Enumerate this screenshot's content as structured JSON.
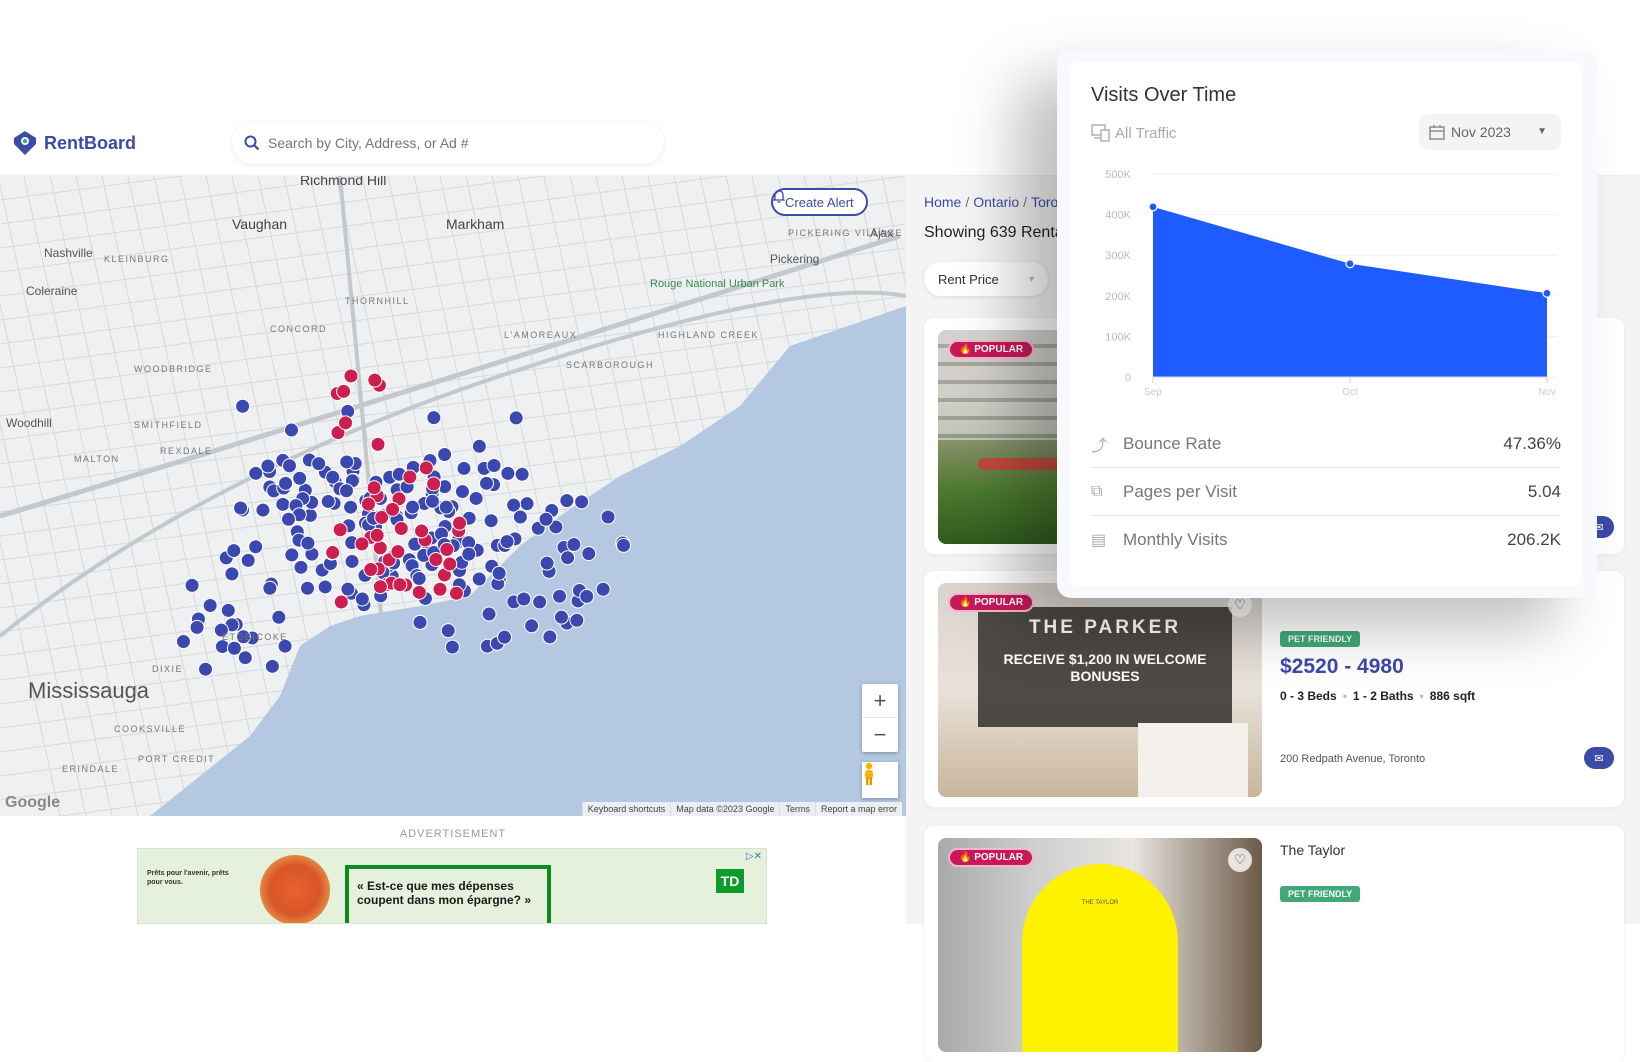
{
  "header": {
    "brand": "RentBoard",
    "search_placeholder": "Search by City, Address, or Ad #"
  },
  "map": {
    "create_alert_label": "Create Alert",
    "zoom_in": "+",
    "zoom_out": "−",
    "google_label": "Google",
    "footer_links": [
      "Keyboard shortcuts",
      "Map data ©2023 Google",
      "Terms",
      "Report a map error"
    ],
    "labels": [
      {
        "text": "Richmond Hill",
        "cls": "big"
      },
      {
        "text": "Vaughan",
        "cls": "big"
      },
      {
        "text": "Markham",
        "cls": "big"
      },
      {
        "text": "Nashville",
        "cls": ""
      },
      {
        "text": "KLEINBURG",
        "cls": "small"
      },
      {
        "text": "Coleraine",
        "cls": ""
      },
      {
        "text": "Pickering",
        "cls": ""
      },
      {
        "text": "PICKERING VILLAGE",
        "cls": "small"
      },
      {
        "text": "Ajax",
        "cls": ""
      },
      {
        "text": "CONCORD",
        "cls": "small"
      },
      {
        "text": "THORNHILL",
        "cls": "small"
      },
      {
        "text": "WOODBRIDGE",
        "cls": "small"
      },
      {
        "text": "Woodhill",
        "cls": ""
      },
      {
        "text": "SMITHFIELD",
        "cls": "small"
      },
      {
        "text": "REXDALE",
        "cls": "small"
      },
      {
        "text": "MALTON",
        "cls": "small"
      },
      {
        "text": "SCARBOROUGH",
        "cls": "small"
      },
      {
        "text": "L'AMOREAUX",
        "cls": "small"
      },
      {
        "text": "HIGHLAND CREEK",
        "cls": "small"
      },
      {
        "text": "Mississauga",
        "cls": "huge"
      },
      {
        "text": "DIXIE",
        "cls": "small"
      },
      {
        "text": "COOKSVILLE",
        "cls": "small"
      },
      {
        "text": "PORT CREDIT",
        "cls": "small"
      },
      {
        "text": "ERINDALE",
        "cls": "small"
      },
      {
        "text": "ETOBICOKE",
        "cls": "small"
      }
    ],
    "park_label": "Rouge National Urban Park"
  },
  "advertisement": {
    "label": "ADVERTISEMENT",
    "small_text": "Prêts pour l'avenir, prêts pour vous.",
    "quote": "« Est-ce que mes dépenses coupent dans mon épargne? »",
    "brand": "TD"
  },
  "listings": {
    "breadcrumb": [
      "Home",
      "Ontario",
      "Toronto"
    ],
    "showing_text": "Showing 639 Rentals",
    "filter_label": "Rent Price",
    "cards": [
      {
        "badge": "POPULAR",
        "name": "",
        "pet": "",
        "price": "",
        "specs": [],
        "address": ""
      },
      {
        "badge": "POPULAR",
        "name": "Parker",
        "pet": "PET FRIENDLY",
        "price": "$2520 - 4980",
        "specs": [
          "0 - 3 Beds",
          "1 - 2 Baths",
          "886 sqft"
        ],
        "address": "200 Redpath Avenue, Toronto",
        "photo_headline": "THE PARKER",
        "photo_sub": "RECEIVE $1,200 IN WELCOME BONUSES"
      },
      {
        "badge": "POPULAR",
        "name": "The Taylor",
        "pet": "PET FRIENDLY",
        "photo_logo": "THE TAYLOR"
      }
    ]
  },
  "popup": {
    "title": "Visits Over Time",
    "traffic_label": "All Traffic",
    "date_selected": "Nov 2023",
    "metrics": [
      {
        "icon": "trend-icon",
        "label": "Bounce Rate",
        "value": "47.36%"
      },
      {
        "icon": "pages-icon",
        "label": "Pages per Visit",
        "value": "5.04"
      },
      {
        "icon": "calendar-icon",
        "label": "Monthly Visits",
        "value": "206.2K"
      }
    ]
  },
  "chart_data": {
    "type": "area",
    "title": "Visits Over Time",
    "categories": [
      "Sep",
      "Oct",
      "Nov"
    ],
    "series": [
      {
        "name": "Visits",
        "values": [
          419000,
          279000,
          206200
        ]
      }
    ],
    "ylim": [
      0,
      500000
    ],
    "yticks": [
      0,
      100000,
      200000,
      300000,
      400000,
      500000
    ],
    "ytick_labels": [
      "0",
      "100K",
      "200K",
      "300K",
      "400K",
      "500K"
    ],
    "grid": true,
    "color": "#1f5cff"
  },
  "colors": {
    "brand": "#3c4aa8",
    "marker_blue": "#3b48b0",
    "marker_red": "#cc1f4f",
    "water": "#b4c9e1"
  }
}
